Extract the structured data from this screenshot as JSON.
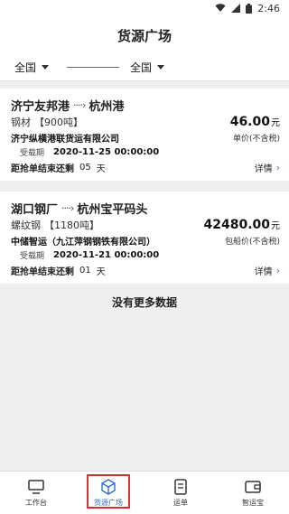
{
  "status_bar": {
    "time": "2:46"
  },
  "header": {
    "title": "货源广场"
  },
  "filters": {
    "from": "全国",
    "to": "全国"
  },
  "cards": [
    {
      "origin": "济宁友邦港",
      "arrow": "····›",
      "destination": "杭州港",
      "goods": "钢材",
      "weight": "【900吨】",
      "price": "46.00",
      "price_unit": "元",
      "company": "济宁纵横港联货运有限公司",
      "price_type": "单价(不含税)",
      "date_label": "受载期",
      "date": "2020-11-25 00:00:00",
      "countdown_label": "距抢单结束还剩",
      "countdown_days": "05",
      "countdown_unit": "天",
      "detail_label": "详情"
    },
    {
      "origin": "湖口钢厂",
      "arrow": "····›",
      "destination": "杭州宝平码头",
      "goods": "螺纹钢",
      "weight": "【1180吨】",
      "price": "42480.00",
      "price_unit": "元",
      "company": "中储智运（九江萍钢钢铁有限公司）",
      "price_type": "包船价(不含税)",
      "date_label": "受载期",
      "date": "2020-11-21 00:00:00",
      "countdown_label": "距抢单结束还剩",
      "countdown_days": "01",
      "countdown_unit": "天",
      "detail_label": "详情"
    }
  ],
  "no_more": "没有更多数据",
  "tabbar": [
    {
      "label": "工作台",
      "icon": "monitor-icon",
      "active": false
    },
    {
      "label": "货源广场",
      "icon": "box-icon",
      "active": true
    },
    {
      "label": "运单",
      "icon": "document-icon",
      "active": false
    },
    {
      "label": "智运宝",
      "icon": "wallet-icon",
      "active": false
    }
  ],
  "colors": {
    "accent": "#2b6fd6",
    "highlight_box": "#d9302b"
  }
}
